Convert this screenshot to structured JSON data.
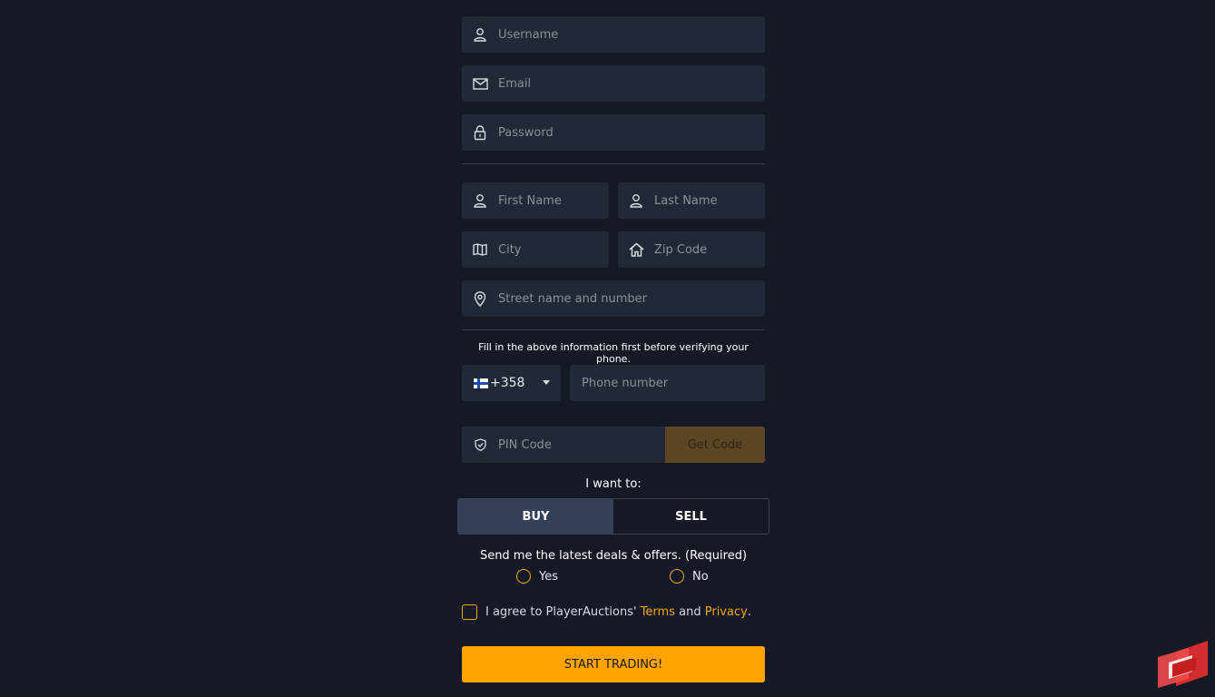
{
  "form": {
    "username": {
      "placeholder": "Username",
      "icon": "user-icon"
    },
    "email": {
      "placeholder": "Email",
      "icon": "mail-icon"
    },
    "password": {
      "placeholder": "Password",
      "icon": "lock-icon"
    },
    "first_name": {
      "placeholder": "First Name",
      "icon": "user-icon"
    },
    "last_name": {
      "placeholder": "Last Name",
      "icon": "user-icon"
    },
    "city": {
      "placeholder": "City",
      "icon": "map-icon"
    },
    "zip": {
      "placeholder": "Zip Code",
      "icon": "home-icon"
    },
    "street": {
      "placeholder": "Street name and number",
      "icon": "location-pin-icon"
    },
    "phone_note": "Fill in the above information first before verifying your phone.",
    "country_code": "+358",
    "country_flag": "finland-flag-icon",
    "phone": {
      "placeholder": "Phone number"
    },
    "pin": {
      "placeholder": "PIN Code",
      "icon": "shield-check-icon"
    },
    "get_code_label": "Get Code",
    "intent_label": "I want to:",
    "buy_label": "BUY",
    "sell_label": "SELL",
    "selected_intent": "BUY",
    "deals_question": "Send me the latest deals & offers. (Required)",
    "yes_label": "Yes",
    "no_label": "No",
    "agree_prefix": "I agree to PlayerAuctions'",
    "terms_label": "Terms",
    "and_text": "and",
    "privacy_label": "Privacy",
    "period": ".",
    "start_label": "START TRADING!"
  },
  "colors": {
    "background": "#141925",
    "field": "#212838",
    "accent": "#ffa400",
    "get_code_bg": "#5c4524",
    "buy_selected": "#343f59"
  }
}
